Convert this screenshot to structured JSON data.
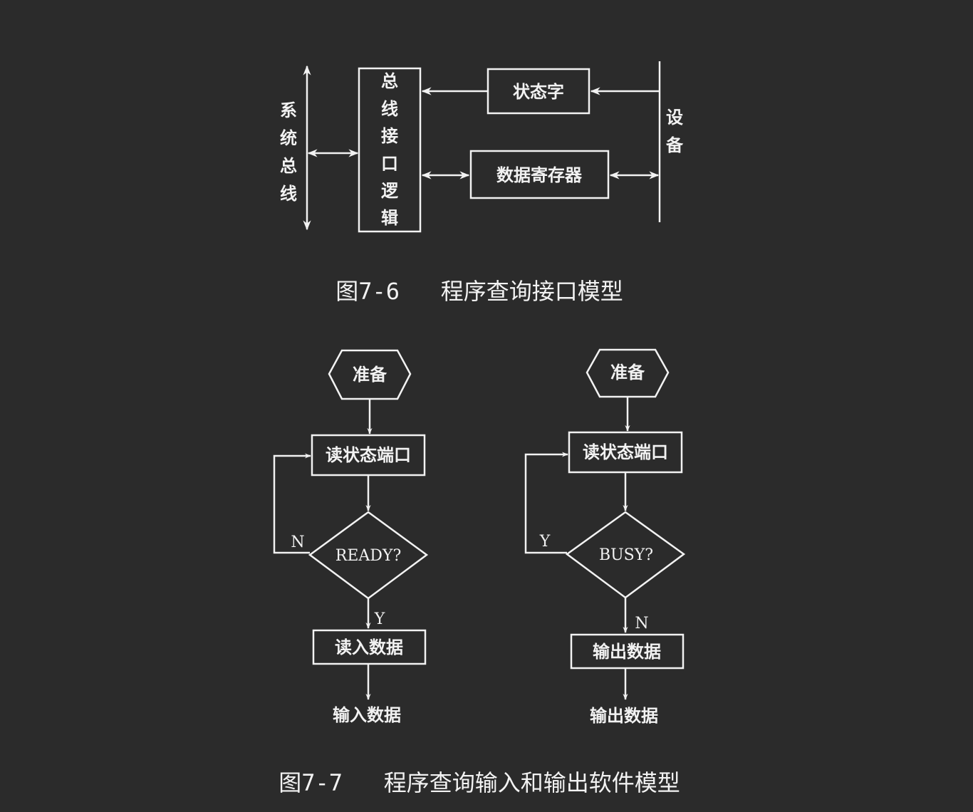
{
  "figure76": {
    "system_bus_chars": [
      "系",
      "统",
      "总",
      "线"
    ],
    "bus_logic_chars": [
      "总",
      "线",
      "接",
      "口",
      "逻",
      "辑"
    ],
    "status_word": "状态字",
    "data_register": "数据寄存器",
    "device_chars": [
      "设",
      "备"
    ],
    "caption": "图7-6   程序查询接口模型"
  },
  "figure77": {
    "input_flow": {
      "start": "准备",
      "read_status": "读状态端口",
      "decision": "READY?",
      "no_label": "N",
      "yes_label": "Y",
      "action": "读入数据",
      "end": "输入数据"
    },
    "output_flow": {
      "start": "准备",
      "read_status": "读状态端口",
      "decision": "BUSY?",
      "yes_label": "Y",
      "no_label": "N",
      "action": "输出数据",
      "end": "输出数据"
    },
    "caption": "图7-7   程序查询输入和输出软件模型"
  }
}
